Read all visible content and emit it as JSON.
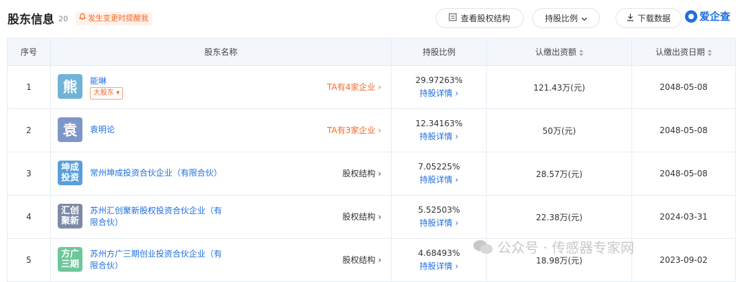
{
  "header": {
    "title": "股东信息",
    "count": "20",
    "remind": "发生变更时提醒我",
    "buttons": {
      "structure": "查看股权结构",
      "ratio": "持股比例",
      "download": "下载数据"
    },
    "logo": "爱企查"
  },
  "table": {
    "columns": [
      "序号",
      "股东名称",
      "持股比例",
      "认缴出资额",
      "认缴出资日期"
    ],
    "detail_label": "持股详情",
    "rows": [
      {
        "index": "1",
        "avatar": "熊",
        "avatar_color": "#6fb3d6",
        "name": "能琳",
        "badge": "大股东",
        "link": "TA有4家企业",
        "link_style": "orange",
        "pct": "29.97263%",
        "amount": "121.43万(元)",
        "date": "2048-05-08"
      },
      {
        "index": "2",
        "avatar": "袁",
        "avatar_color": "#7f96c8",
        "name": "袁明论",
        "badge": "",
        "link": "TA有3家企业",
        "link_style": "orange",
        "pct": "12.34163%",
        "amount": "50万(元)",
        "date": "2048-05-08"
      },
      {
        "index": "3",
        "avatar": "坤成投资",
        "avatar_color": "#5a9fd9",
        "name": "常州坤成投资合伙企业（有限合伙）",
        "badge": "",
        "link": "股权结构",
        "link_style": "gray",
        "pct": "7.05225%",
        "amount": "28.57万(元)",
        "date": "2048-05-08"
      },
      {
        "index": "4",
        "avatar": "汇创聚新",
        "avatar_color": "#7d8aa6",
        "name": "苏州汇创聚新股权投资合伙企业（有限合伙）",
        "badge": "",
        "link": "股权结构",
        "link_style": "gray",
        "pct": "5.52503%",
        "amount": "22.38万(元)",
        "date": "2024-03-31"
      },
      {
        "index": "5",
        "avatar": "方广三期",
        "avatar_color": "#6cc79a",
        "name": "苏州方广三期创业投资合伙企业（有限合伙）",
        "badge": "",
        "link": "股权结构",
        "link_style": "gray",
        "pct": "4.68493%",
        "amount": "18.98万(元)",
        "date": "2023-09-02"
      }
    ]
  },
  "watermark": "公众号 · 传感器专家网"
}
